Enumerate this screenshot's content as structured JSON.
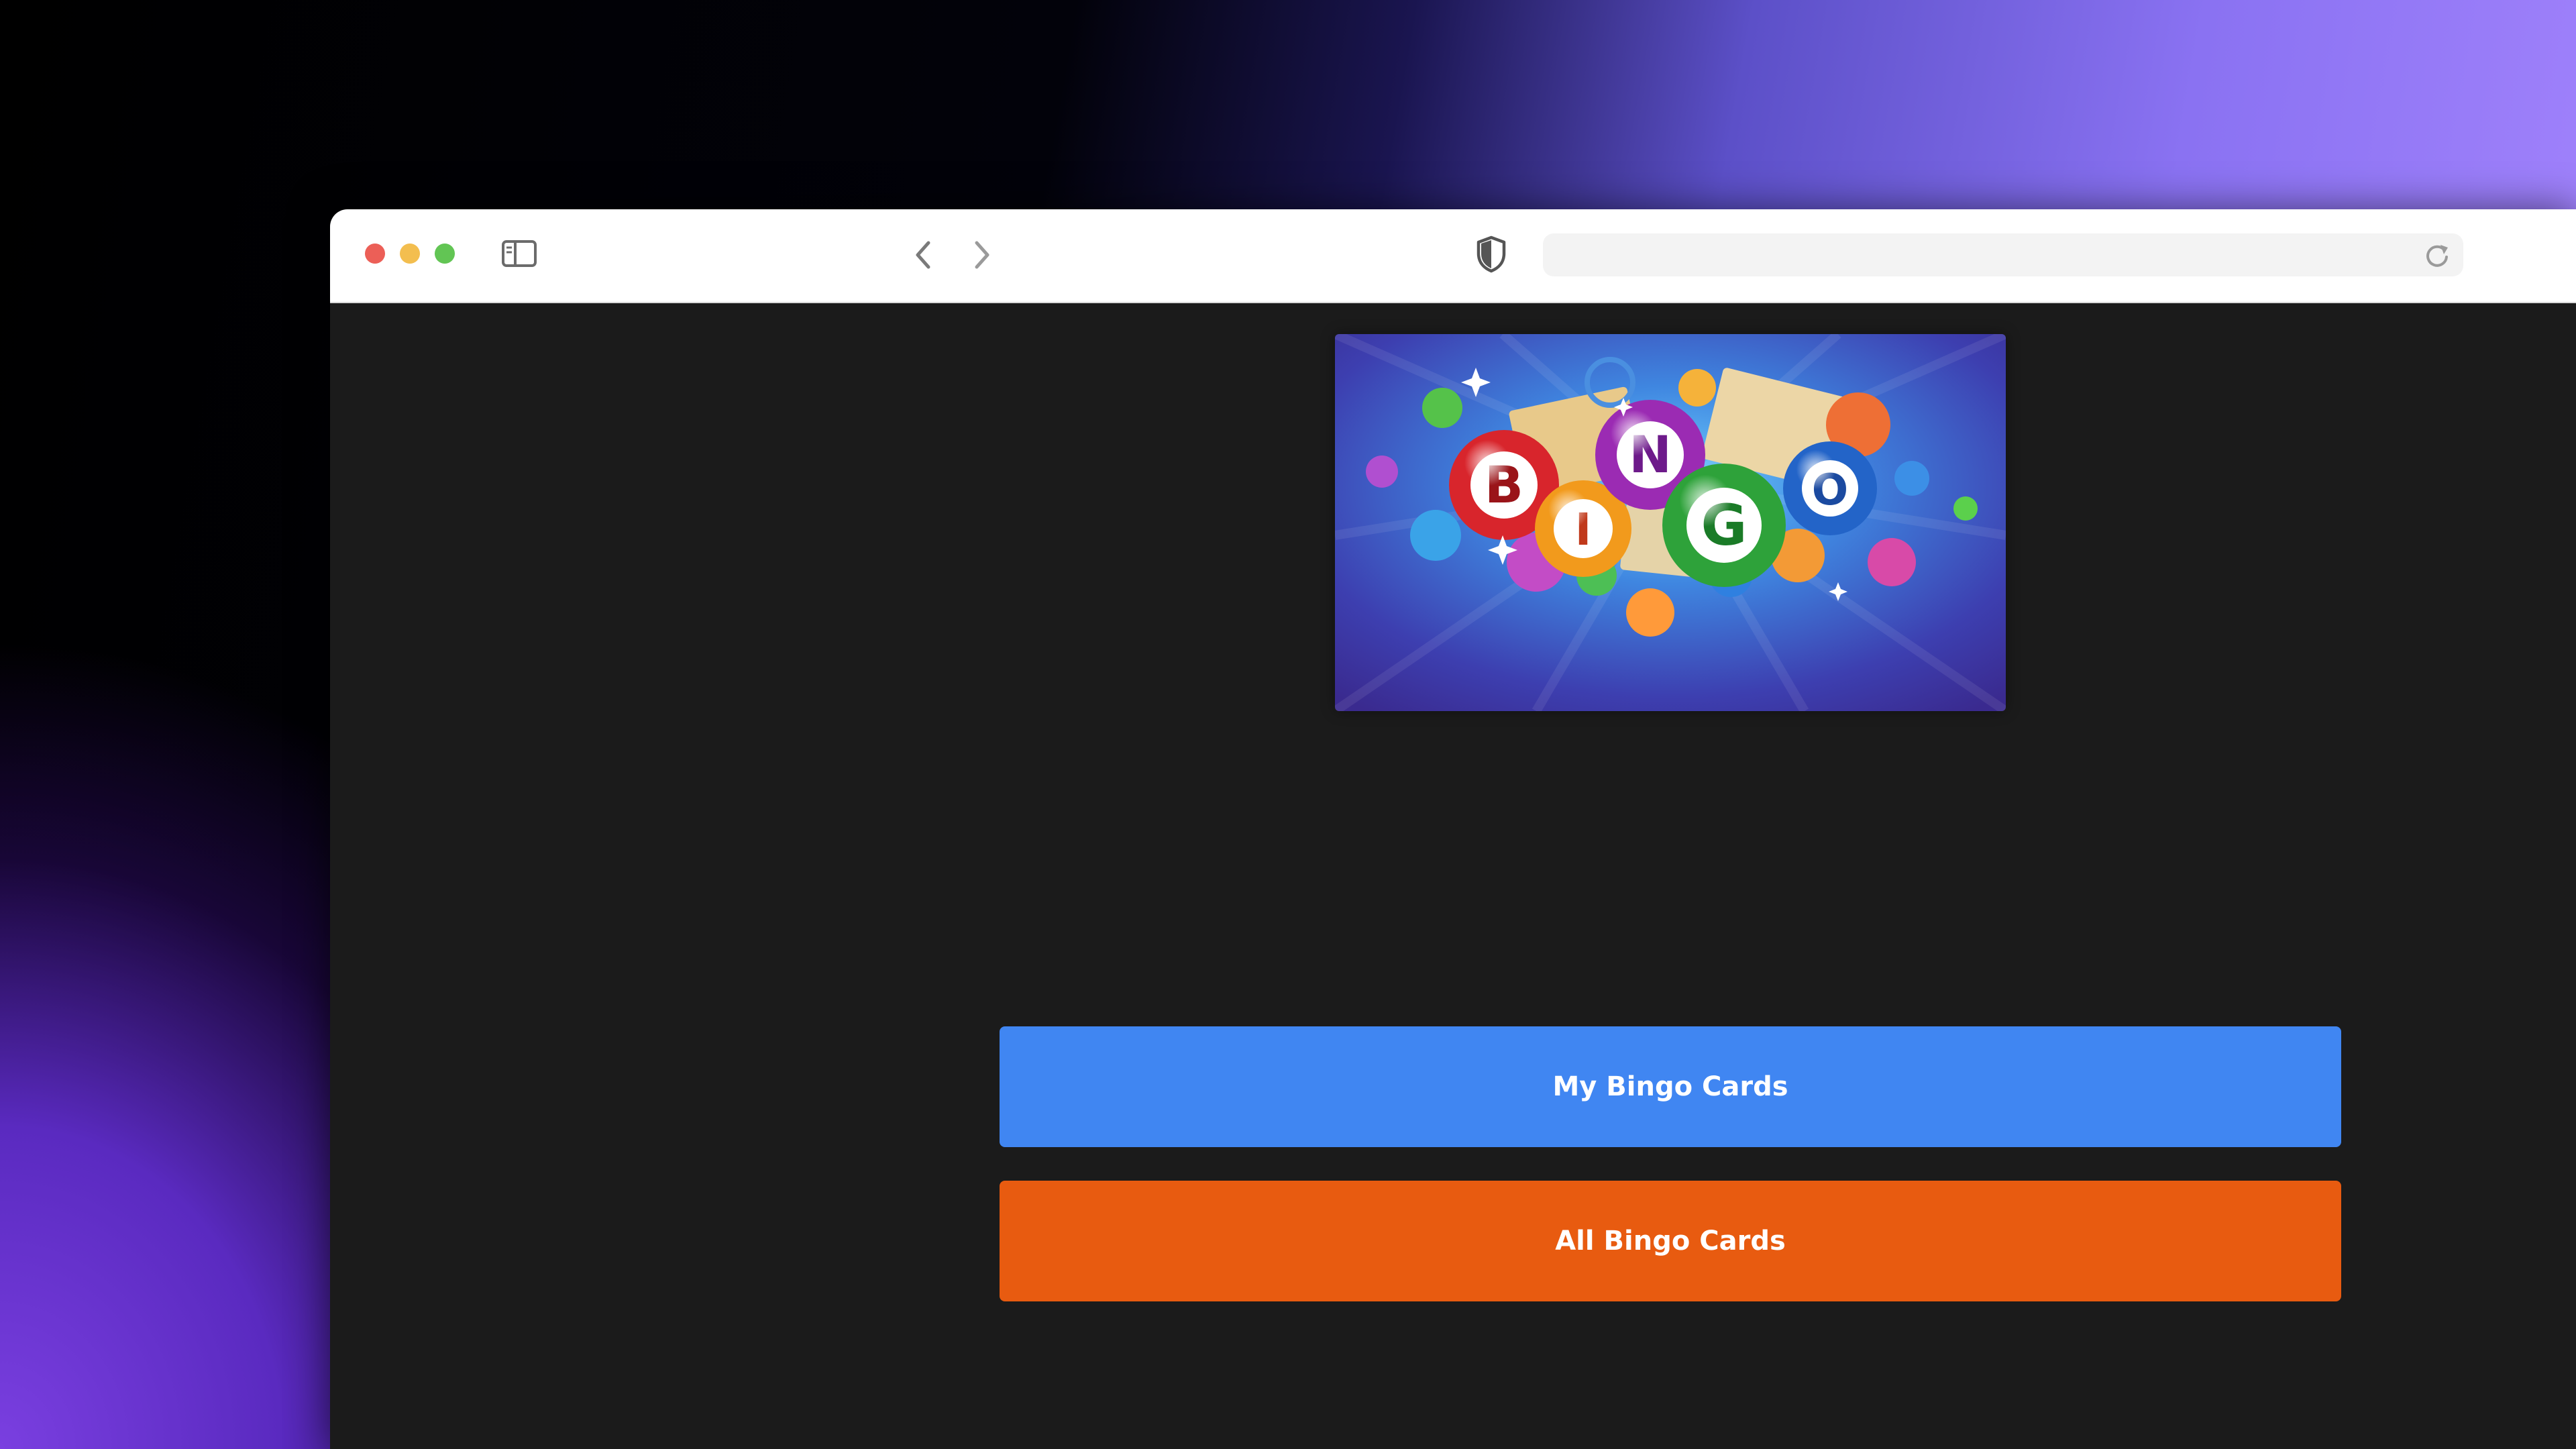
{
  "browser": {
    "address_value": "",
    "icons": {
      "sidebar": "sidebar-toggle-icon",
      "back": "chevron-left-icon",
      "forward": "chevron-right-icon",
      "privacy": "shield-icon",
      "reload": "reload-icon"
    }
  },
  "page": {
    "banner_letters": [
      "B",
      "I",
      "N",
      "G",
      "O"
    ],
    "buttons": {
      "my_cards": "My Bingo Cards",
      "all_cards": "All Bingo Cards"
    }
  },
  "colors": {
    "my_cards_button": "#4086f2",
    "all_cards_button": "#e85b10",
    "page_background": "#1b1b1b"
  }
}
